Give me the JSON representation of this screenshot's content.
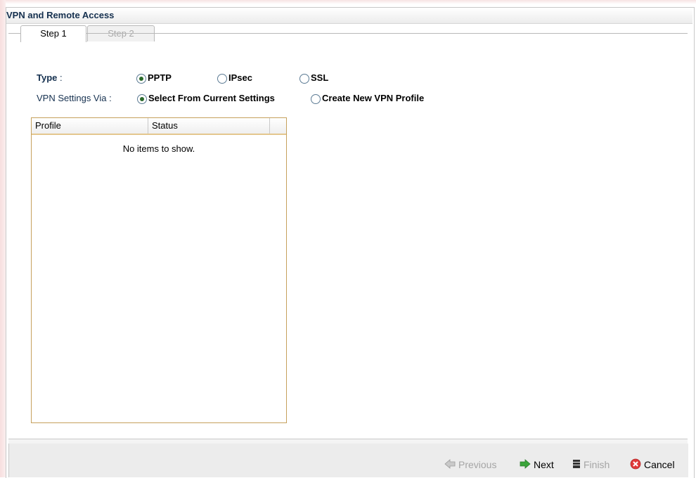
{
  "window": {
    "title": "VPN and Remote Access"
  },
  "tabs": [
    {
      "label": "Step 1",
      "active": true
    },
    {
      "label": "Step 2",
      "active": false
    }
  ],
  "form": {
    "type_label": "Type",
    "type_colon": ":",
    "type_options": [
      {
        "label": "PPTP",
        "checked": true
      },
      {
        "label": "IPsec",
        "checked": false
      },
      {
        "label": "SSL",
        "checked": false
      }
    ],
    "via_label": "VPN Settings Via :",
    "via_options": [
      {
        "label": "Select From Current Settings",
        "checked": true
      },
      {
        "label": "Create New VPN Profile",
        "checked": false
      }
    ]
  },
  "grid": {
    "columns": [
      "Profile",
      "Status"
    ],
    "empty_text": "No items to show."
  },
  "footer": {
    "previous": "Previous",
    "next": "Next",
    "finish": "Finish",
    "cancel": "Cancel"
  },
  "colors": {
    "label_blue": "#15304f",
    "grid_border": "#c6a15c",
    "next_icon": "#3aa53a",
    "cancel_icon": "#e03a3a"
  },
  "icons": {
    "previous": "arrow-left-icon",
    "next": "arrow-right-icon",
    "finish": "finish-flag-icon",
    "cancel": "cancel-x-icon"
  }
}
